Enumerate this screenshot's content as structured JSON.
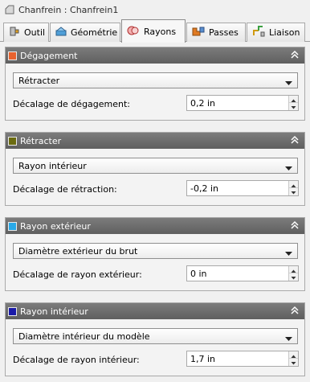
{
  "window": {
    "title": "Chanfrein : Chanfrein1"
  },
  "tabs": [
    {
      "label": "Outil",
      "icon": "tool-icon",
      "active": false
    },
    {
      "label": "Géométrie",
      "icon": "geometry-icon",
      "active": false
    },
    {
      "label": "Rayons",
      "icon": "radii-icon",
      "active": true
    },
    {
      "label": "Passes",
      "icon": "passes-icon",
      "active": false
    },
    {
      "label": "Liaison",
      "icon": "linking-icon",
      "active": false
    }
  ],
  "panels": [
    {
      "title": "Dégagement",
      "color": "#e8622e",
      "select_value": "Rétracter",
      "field_label": "Décalage de dégagement:",
      "field_value": "0,2 in"
    },
    {
      "title": "Rétracter",
      "color": "#6b6b10",
      "select_value": "Rayon intérieur",
      "field_label": "Décalage de rétraction:",
      "field_value": "-0,2 in"
    },
    {
      "title": "Rayon extérieur",
      "color": "#29a9e8",
      "select_value": "Diamètre extérieur du brut",
      "field_label": "Décalage de rayon extérieur:",
      "field_value": "0 in"
    },
    {
      "title": "Rayon intérieur",
      "color": "#1a1aa8",
      "select_value": "Diamètre intérieur du modèle",
      "field_label": "Décalage de rayon intérieur:",
      "field_value": "1,7 in"
    }
  ]
}
